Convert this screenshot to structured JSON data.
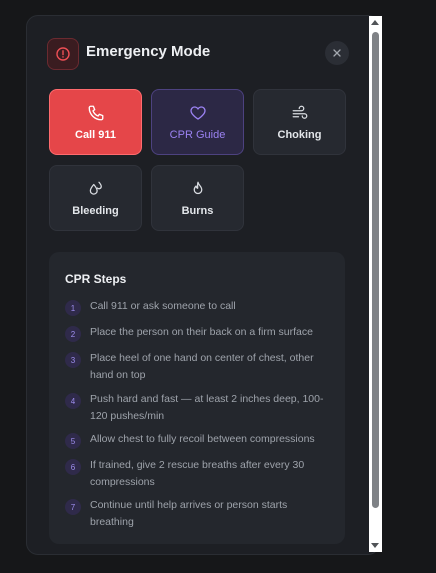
{
  "header": {
    "title": "Emergency Mode",
    "icon": "alert-circle-icon",
    "close_icon": "close-icon"
  },
  "actions": [
    {
      "label": "Call 911",
      "icon": "phone-icon",
      "state": "active"
    },
    {
      "label": "CPR Guide",
      "icon": "heart-icon",
      "state": "selected"
    },
    {
      "label": "Choking",
      "icon": "wind-icon",
      "state": "default"
    },
    {
      "label": "Bleeding",
      "icon": "droplets-icon",
      "state": "default"
    },
    {
      "label": "Burns",
      "icon": "flame-icon",
      "state": "default"
    }
  ],
  "cpr": {
    "title": "CPR Steps",
    "steps": [
      {
        "num": "1",
        "text": "Call 911 or ask someone to call"
      },
      {
        "num": "2",
        "text": "Place the person on their back on a firm surface"
      },
      {
        "num": "3",
        "text": "Place heel of one hand on center of chest, other hand on top"
      },
      {
        "num": "4",
        "text": "Push hard and fast — at least 2 inches deep, 100-120 pushes/min"
      },
      {
        "num": "5",
        "text": "Allow chest to fully recoil between compressions"
      },
      {
        "num": "6",
        "text": "If trained, give 2 rescue breaths after every 30 compressions"
      },
      {
        "num": "7",
        "text": "Continue until help arrives or person starts breathing"
      }
    ]
  },
  "colors": {
    "danger": "#e54649",
    "accent": "#9b82f2",
    "panel": "#1d1f24"
  }
}
